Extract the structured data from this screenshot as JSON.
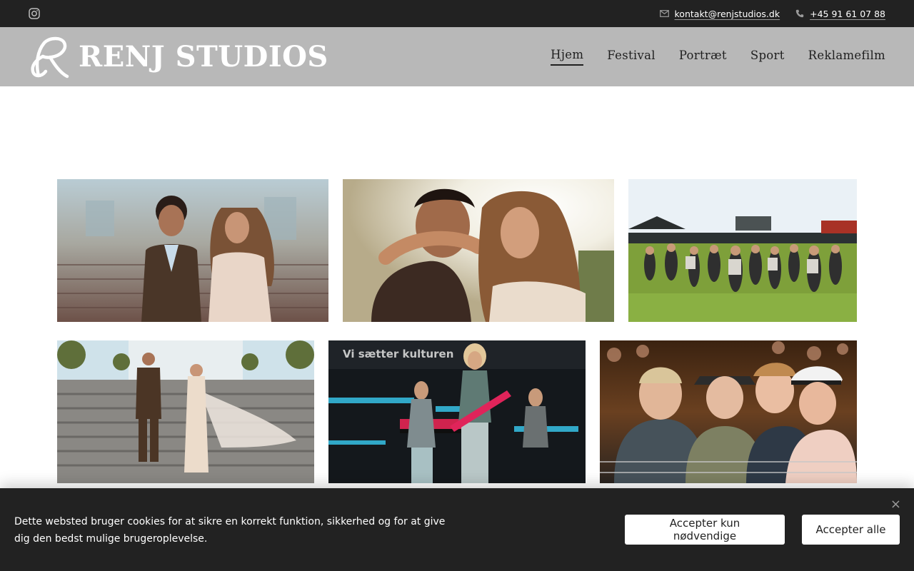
{
  "topbar": {
    "email": "kontakt@renjstudios.dk",
    "phone": "+45 91 61 07 88"
  },
  "header": {
    "brand": "RENJ STUDIOS",
    "nav": [
      {
        "label": "Hjem",
        "active": true
      },
      {
        "label": "Festival",
        "active": false
      },
      {
        "label": "Portræt",
        "active": false
      },
      {
        "label": "Sport",
        "active": false
      },
      {
        "label": "Reklamefilm",
        "active": false
      }
    ]
  },
  "gallery": {
    "photos": [
      "wedding-couple-stairs",
      "wedding-couple-embrace",
      "festival-crowd-field",
      "wedding-couple-veil",
      "band-on-stage",
      "festival-crowd-cheering"
    ],
    "stage_banner_text": "Vi sætter kulturen"
  },
  "cookie_banner": {
    "message": "Dette websted bruger cookies for at sikre en korrekt funktion, sikkerhed og for at give dig den bedst mulige brugeroplevelse.",
    "btn_necessary": "Accepter kun nødvendige",
    "btn_all": "Accepter alle",
    "close": "×"
  },
  "colors": {
    "topbar": "#222222",
    "header": "#b8b8b8",
    "cookie_bg": "#222222"
  }
}
